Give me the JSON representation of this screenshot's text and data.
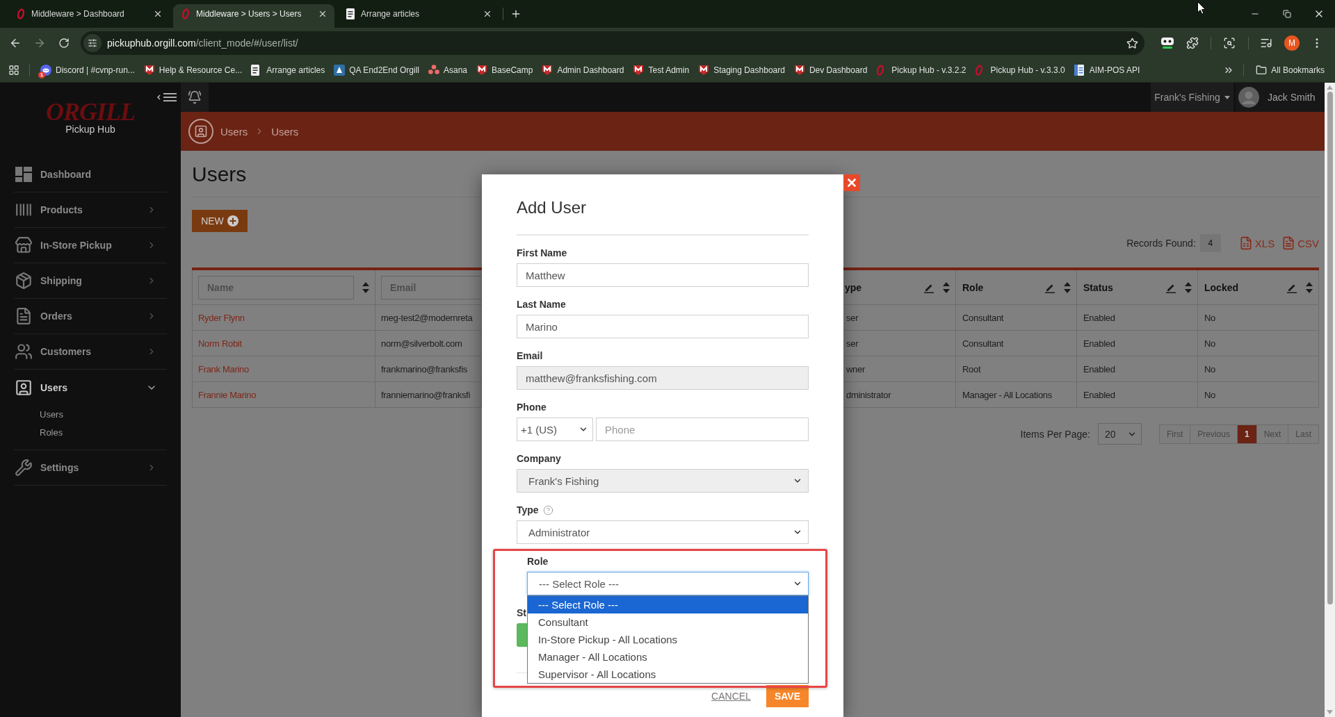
{
  "browser": {
    "tabs": [
      {
        "title": "Middleware > Dashboard",
        "kind": "orgill",
        "selected": false
      },
      {
        "title": "Middleware > Users > Users",
        "kind": "orgill",
        "selected": true
      },
      {
        "title": "Arrange articles",
        "kind": "doc",
        "selected": false
      }
    ],
    "address": {
      "host": "pickuphub.orgill.com",
      "path": "/client_mode/#/user/list/"
    },
    "profile_initial": "M",
    "bookmarks": [
      {
        "label": "Discord | #cvnp-run...",
        "kind": "chat",
        "badge": "1"
      },
      {
        "label": "Help & Resource Ce...",
        "kind": "shield"
      },
      {
        "label": "Arrange articles",
        "kind": "doc"
      },
      {
        "label": "QA End2End Orgill",
        "kind": "square"
      },
      {
        "label": "Asana",
        "kind": "dots"
      },
      {
        "label": "BaseCamp",
        "kind": "shield"
      },
      {
        "label": "Admin Dashboard",
        "kind": "shield"
      },
      {
        "label": "Test Admin",
        "kind": "shield"
      },
      {
        "label": "Staging Dashboard",
        "kind": "shield"
      },
      {
        "label": "Dev Dashboard",
        "kind": "shield"
      },
      {
        "label": "Pickup Hub - v.3.2.2",
        "kind": "oval"
      },
      {
        "label": "Pickup Hub - v.3.3.0",
        "kind": "oval"
      },
      {
        "label": "AIM-POS API",
        "kind": "sheet"
      }
    ],
    "all_bookmarks": "All Bookmarks"
  },
  "sidebar": {
    "logo": "ORGILL",
    "subtitle": "Pickup Hub",
    "items": [
      {
        "label": "Dashboard",
        "kind": "link",
        "selected": false
      },
      {
        "label": "Products",
        "kind": "group",
        "selected": false,
        "expanded": false
      },
      {
        "label": "In-Store Pickup",
        "kind": "group",
        "selected": false,
        "expanded": false
      },
      {
        "label": "Shipping",
        "kind": "group",
        "selected": false,
        "expanded": false
      },
      {
        "label": "Orders",
        "kind": "group",
        "selected": false,
        "expanded": false
      },
      {
        "label": "Customers",
        "kind": "group",
        "selected": false,
        "expanded": false
      },
      {
        "label": "Users",
        "kind": "group",
        "selected": true,
        "expanded": true,
        "children": [
          {
            "label": "Users",
            "selected": false
          },
          {
            "label": "Roles",
            "selected": false
          }
        ]
      },
      {
        "label": "Settings",
        "kind": "group",
        "selected": false,
        "expanded": false
      }
    ]
  },
  "topbar": {
    "company": "Frank's Fishing",
    "user": "Jack Smith"
  },
  "breadcrumb": [
    {
      "label": "Users"
    },
    {
      "label": "Users"
    }
  ],
  "page": {
    "title": "Users",
    "new_button": "NEW",
    "records_label": "Records Found:",
    "records_count": "4",
    "exports": [
      {
        "label": "XLS",
        "kind": "sheet"
      },
      {
        "label": "CSV",
        "kind": "text"
      }
    ]
  },
  "table": {
    "columns": [
      {
        "placeholder": "Name",
        "kind": "filter",
        "sortable": true,
        "editable": false
      },
      {
        "placeholder": "Email",
        "kind": "filter",
        "sortable": false,
        "editable": false
      },
      {
        "label": "ype",
        "kind": "text",
        "sortable": true,
        "editable": true
      },
      {
        "label": "Role",
        "kind": "text",
        "sortable": true,
        "editable": true
      },
      {
        "label": "Status",
        "kind": "text",
        "sortable": true,
        "editable": true
      },
      {
        "label": "Locked",
        "kind": "text",
        "sortable": true,
        "editable": true
      }
    ],
    "rows": [
      {
        "cells": [
          "Ryder Flynn",
          "meg-test2@modernreta",
          "ser",
          "Consultant",
          "Enabled",
          "No"
        ]
      },
      {
        "cells": [
          "Norm Robit",
          "norm@silverbolt.com",
          "ser",
          "Consultant",
          "Enabled",
          "No"
        ]
      },
      {
        "cells": [
          "Frank Marino",
          "frankmarino@franksfis",
          "wner",
          "Root",
          "Enabled",
          "No"
        ]
      },
      {
        "cells": [
          "Frannie Marino",
          "franniemarino@franksfi",
          "dministrator",
          "Manager - All Locations",
          "Enabled",
          "No"
        ]
      }
    ]
  },
  "pagination": {
    "items_label": "Items Per Page:",
    "per_page": "20",
    "pages": [
      {
        "label": "First",
        "selected": false
      },
      {
        "label": "Previous",
        "selected": false
      },
      {
        "label": "1",
        "selected": true
      },
      {
        "label": "Next",
        "selected": false
      },
      {
        "label": "Last",
        "selected": false
      }
    ]
  },
  "modal": {
    "title": "Add User",
    "fields": [
      {
        "label": "First Name",
        "kind": "text",
        "value": "Matthew",
        "disabled": false,
        "help": false
      },
      {
        "label": "Last Name",
        "kind": "text",
        "value": "Marino",
        "disabled": false,
        "help": false
      },
      {
        "label": "Email",
        "kind": "text",
        "value": "matthew@franksfishing.com",
        "disabled": true,
        "help": false
      },
      {
        "label": "Phone",
        "kind": "phone",
        "code": "+1 (US)",
        "placeholder": "Phone",
        "help": false
      },
      {
        "label": "Company",
        "kind": "select",
        "value": "Frank's Fishing",
        "disabled": true,
        "help": false
      },
      {
        "label": "Type",
        "kind": "select",
        "value": "Administrator",
        "disabled": false,
        "help": true
      },
      {
        "label": "Role",
        "kind": "dropdown",
        "value": "--- Select Role ---",
        "focused": true,
        "open": true,
        "highlighted": true,
        "help": false,
        "options": [
          {
            "label": "--- Select Role ---",
            "selected": true
          },
          {
            "label": "Consultant",
            "selected": false
          },
          {
            "label": "In-Store Pickup - All Locations",
            "selected": false
          },
          {
            "label": "Manager - All Locations",
            "selected": false
          },
          {
            "label": "Supervisor - All Locations",
            "selected": false
          }
        ]
      },
      {
        "label": "St",
        "kind": "toggle",
        "on": true,
        "help": false
      }
    ],
    "cancel": "CANCEL",
    "save": "SAVE"
  }
}
